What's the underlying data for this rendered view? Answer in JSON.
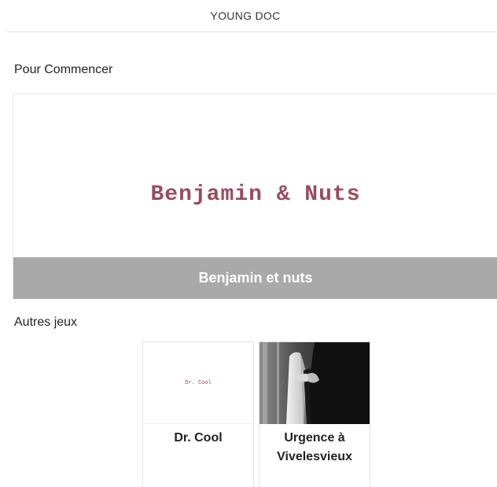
{
  "header": {
    "title": "YOUNG DOC"
  },
  "sections": {
    "start_title": "Pour Commencer",
    "others_title": "Autres jeux"
  },
  "featured": {
    "logo_text": "Benjamin & Nuts",
    "caption": "Benjamin et nuts",
    "logo_color": "#9a4a5e",
    "caption_bg": "#a9a9a9"
  },
  "games": [
    {
      "thumb_text": "Dr. Cool",
      "title": "Dr. Cool",
      "thumb_type": "text-logo"
    },
    {
      "title": "Urgence à Vivelesvieux",
      "thumb_type": "photo",
      "thumb_description_icon": "doctor-photo"
    }
  ]
}
